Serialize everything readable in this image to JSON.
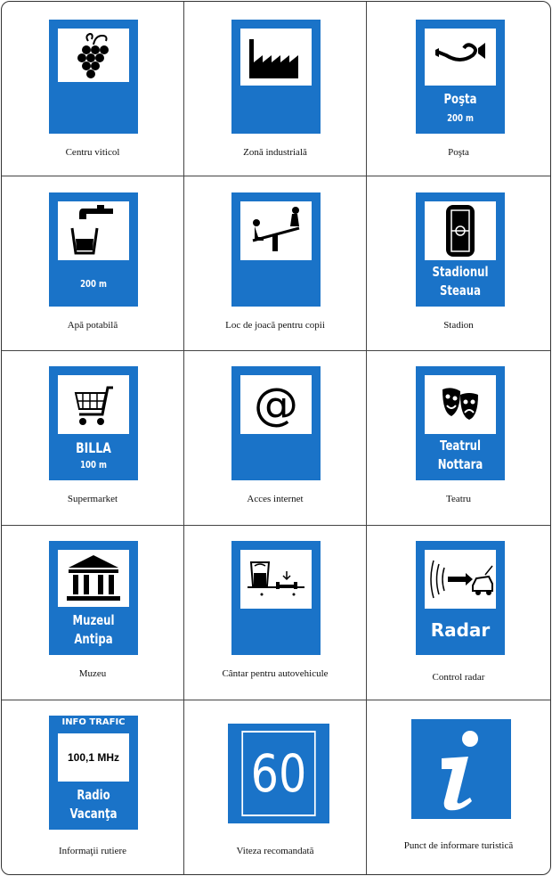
{
  "colors": {
    "sign_blue": "#1a73c8",
    "border": "#444444"
  },
  "cells": [
    {
      "caption": "Centru viticol",
      "icon": "grapes-icon"
    },
    {
      "caption": "Zonă industrială",
      "icon": "factory-icon"
    },
    {
      "caption": "Poşta",
      "icon": "post-horn-icon",
      "sign_text": "Poşta",
      "distance": "200 m"
    },
    {
      "caption": "Apă potabilă",
      "icon": "water-tap-icon",
      "distance": "200 m"
    },
    {
      "caption": "Loc de joacă pentru copii",
      "icon": "playground-seesaw-icon"
    },
    {
      "caption": "Stadion",
      "icon": "stadium-icon",
      "sign_text_1": "Stadionul",
      "sign_text_2": "Steaua"
    },
    {
      "caption": "Supermarket",
      "icon": "shopping-cart-icon",
      "sign_text": "BILLA",
      "distance": "100 m"
    },
    {
      "caption": "Acces internet",
      "icon": "at-sign-icon",
      "symbol": "@"
    },
    {
      "caption": "Teatru",
      "icon": "theatre-masks-icon",
      "sign_text_1": "Teatrul",
      "sign_text_2": "Nottara"
    },
    {
      "caption": "Muzeu",
      "icon": "museum-icon",
      "sign_text_1": "Muzeul",
      "sign_text_2": "Antipa"
    },
    {
      "caption": "Cântar pentru autovehicule",
      "icon": "vehicle-scale-icon"
    },
    {
      "caption": "Control radar",
      "icon": "radar-car-icon",
      "sign_text": "Radar"
    },
    {
      "caption": "Informaţii rutiere",
      "header": "INFO TRAFIC",
      "frequency": "100,1 MHz",
      "sign_text_1": "Radio",
      "sign_text_2": "Vacanţa"
    },
    {
      "caption": "Viteza recomandată",
      "speed": "60"
    },
    {
      "caption": "Punct de informare turistică",
      "icon": "info-i-icon"
    }
  ]
}
